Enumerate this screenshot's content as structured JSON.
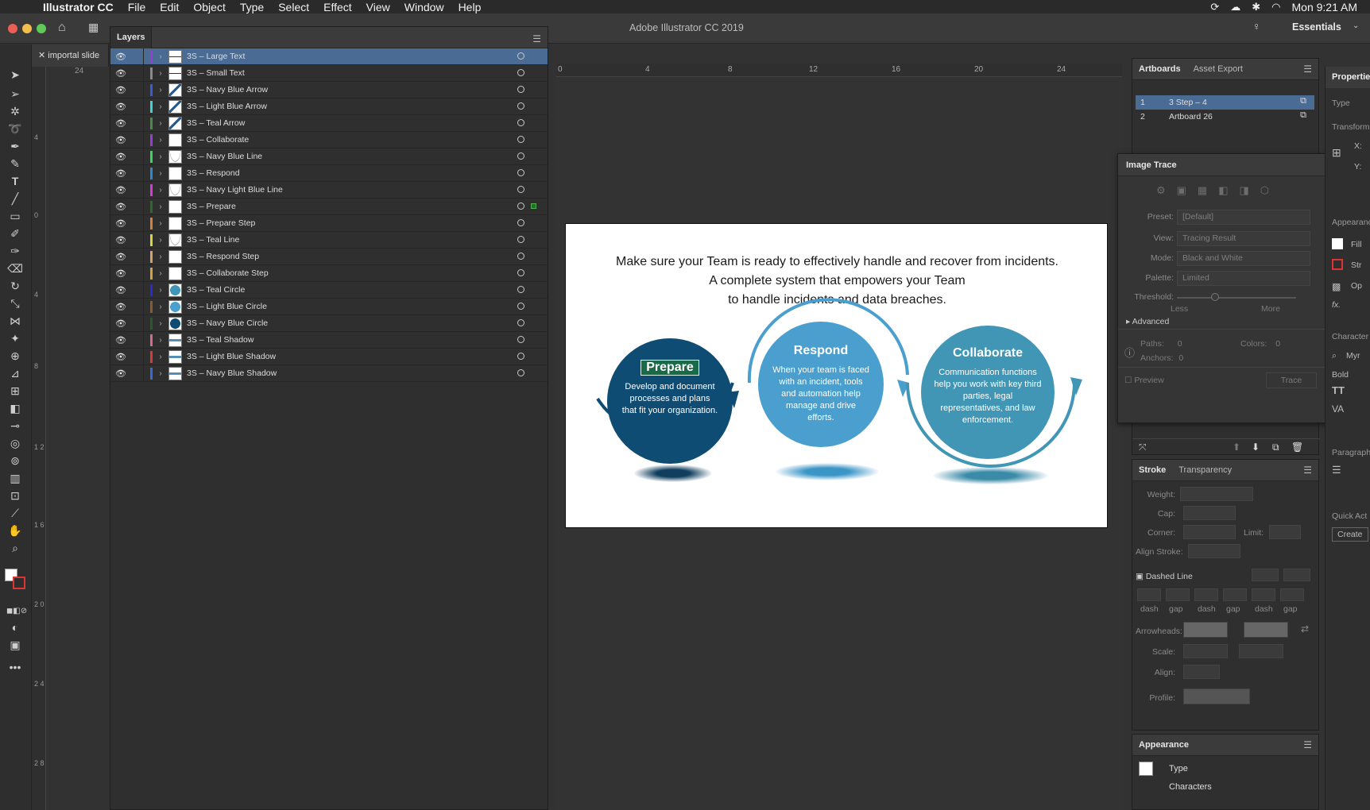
{
  "menubar": {
    "app": "Illustrator CC",
    "items": [
      "File",
      "Edit",
      "Object",
      "Type",
      "Select",
      "Effect",
      "View",
      "Window",
      "Help"
    ],
    "clock": "Mon 9:21 AM"
  },
  "window": {
    "title": "Adobe Illustrator CC 2019",
    "workspace": "Essentials"
  },
  "document_tab": "importal slide",
  "layers_panel": {
    "tab": "Layers",
    "layers": [
      {
        "name": "3S – Large Text",
        "color": "#9b3bd6",
        "thumb": "text"
      },
      {
        "name": "3S – Small Text",
        "color": "#8a8a8a",
        "thumb": "text"
      },
      {
        "name": "3S – Navy Blue Arrow",
        "color": "#3a5ad6",
        "thumb": "arrow"
      },
      {
        "name": "3S – Light Blue Arrow",
        "color": "#3ad6d6",
        "thumb": "arrow"
      },
      {
        "name": "3S – Teal Arrow",
        "color": "#4a8a4a",
        "thumb": "arrow"
      },
      {
        "name": "3S – Collaborate",
        "color": "#9b3bd6",
        "thumb": "blank"
      },
      {
        "name": "3S – Navy Blue Line",
        "color": "#3ad65a",
        "thumb": "line"
      },
      {
        "name": "3S – Respond",
        "color": "#2a8ad6",
        "thumb": "blank"
      },
      {
        "name": "3S – Navy Light Blue Line",
        "color": "#d63ad6",
        "thumb": "line"
      },
      {
        "name": "3S – Prepare",
        "color": "#2a6a2a",
        "thumb": "blank"
      },
      {
        "name": "3S – Prepare Step",
        "color": "#d6803a",
        "thumb": "blank"
      },
      {
        "name": "3S – Teal Line",
        "color": "#d6d63a",
        "thumb": "line"
      },
      {
        "name": "3S – Respond Step",
        "color": "#d6a06a",
        "thumb": "blank"
      },
      {
        "name": "3S – Collaborate Step",
        "color": "#d6a03a",
        "thumb": "blank"
      },
      {
        "name": "3S – Teal Circle",
        "color": "#2a2ad6",
        "thumb": "teal-circle"
      },
      {
        "name": "3S – Light Blue Circle",
        "color": "#8a5a2a",
        "thumb": "light-circle"
      },
      {
        "name": "3S – Navy Blue Circle",
        "color": "#2a5a2a",
        "thumb": "navy-circle"
      },
      {
        "name": "3S – Teal Shadow",
        "color": "#d66a8a",
        "thumb": "shadow"
      },
      {
        "name": "3S – Light Blue Shadow",
        "color": "#d63a3a",
        "thumb": "shadow"
      },
      {
        "name": "3S – Navy Blue Shadow",
        "color": "#3a6ad6",
        "thumb": "shadow"
      }
    ]
  },
  "ruler": {
    "h_labels": [
      "0",
      "4",
      "8",
      "12",
      "16",
      "20",
      "24"
    ],
    "v_labels": [
      "4",
      "0",
      "4",
      "8",
      "1 2",
      "1 6",
      "2 0",
      "2 4",
      "2 8"
    ],
    "top_left": "24"
  },
  "artboard": {
    "headline_1": "Make sure your Team is ready to effectively handle and recover from incidents.",
    "headline_2": "A complete system that empowers your Team",
    "headline_3": "to handle incidents and data breaches.",
    "steps": [
      {
        "title": "Prepare",
        "desc": "Develop and document processes and plans that fit your organization.",
        "color": "#0f4c73"
      },
      {
        "title": "Respond",
        "desc": "When your team is faced with an incident, tools and automation help manage and drive efforts.",
        "color": "#4a9fcf"
      },
      {
        "title": "Collaborate",
        "desc": "Communication functions help you work with key third parties, legal representatives, and law enforcement.",
        "color": "#4196b5"
      }
    ]
  },
  "artboards_panel": {
    "tabs": [
      "Artboards",
      "Asset Export"
    ],
    "rows": [
      {
        "num": "1",
        "name": "3 Step – 4"
      },
      {
        "num": "2",
        "name": "Artboard 26"
      }
    ]
  },
  "image_trace": {
    "title": "Image Trace",
    "preset_label": "Preset:",
    "preset": "[Default]",
    "view_label": "View:",
    "view": "Tracing Result",
    "mode_label": "Mode:",
    "mode": "Black and White",
    "palette_label": "Palette:",
    "palette": "Limited",
    "threshold_label": "Threshold:",
    "less": "Less",
    "more": "More",
    "advanced": "Advanced",
    "paths_label": "Paths:",
    "paths": "0",
    "colors_label": "Colors:",
    "colors": "0",
    "anchors_label": "Anchors:",
    "anchors": "0",
    "preview": "Preview",
    "trace": "Trace"
  },
  "stroke_panel": {
    "tabs": [
      "Stroke",
      "Transparency"
    ],
    "weight": "Weight:",
    "cap": "Cap:",
    "corner": "Corner:",
    "limit": "Limit:",
    "align_stroke": "Align Stroke:",
    "dashed_line": "Dashed Line",
    "dash_labels": [
      "dash",
      "gap",
      "dash",
      "gap",
      "dash",
      "gap"
    ],
    "arrowheads": "Arrowheads:",
    "scale": "Scale:",
    "align": "Align:",
    "profile": "Profile:"
  },
  "appearance_panel": {
    "tab": "Appearance",
    "type": "Type",
    "characters": "Characters"
  },
  "properties_panel": {
    "tab": "Properties",
    "type": "Type",
    "transform": "Transform",
    "x": "X:",
    "y": "Y:",
    "appearance": "Appearance",
    "fill": "Fill",
    "stroke": "Str",
    "opacity": "Op",
    "character": "Character",
    "font": "Myr",
    "style": "Bold",
    "paragraph": "Paragraph",
    "quick_actions": "Quick Act",
    "create": "Create"
  }
}
